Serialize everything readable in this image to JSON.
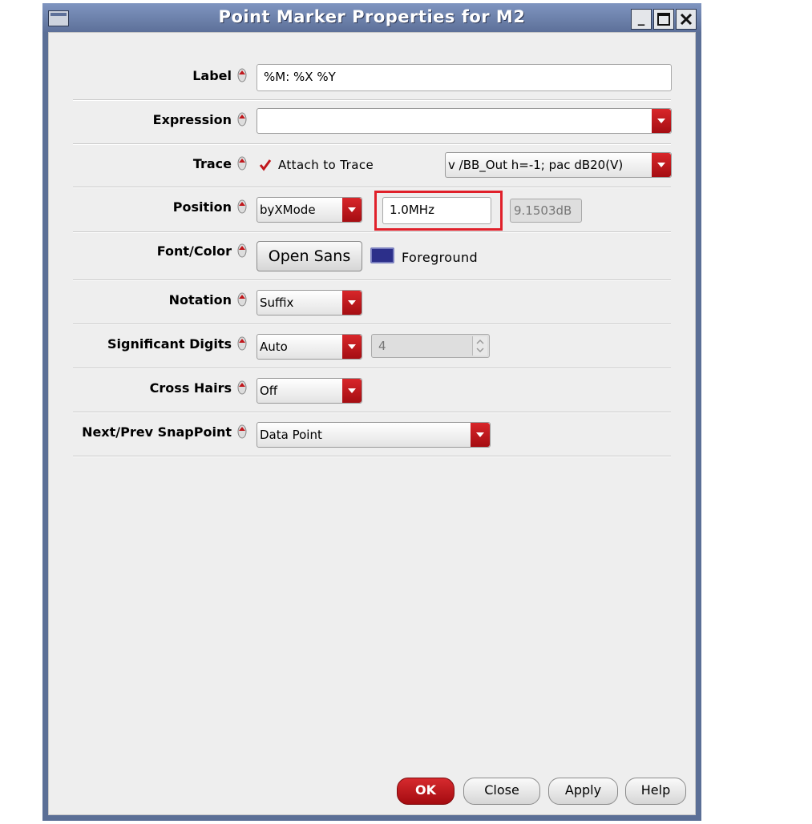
{
  "window": {
    "title": "Point Marker Properties for M2",
    "min_label": "_",
    "max_label": "☐",
    "close_label": "X"
  },
  "rows": {
    "label": {
      "label": "Label",
      "value": "%M: %X %Y"
    },
    "expression": {
      "label": "Expression",
      "value": ""
    },
    "trace": {
      "label": "Trace",
      "checkbox_label": "Attach to Trace",
      "checked": true,
      "select_value": "v /BB_Out h=-1; pac dB20(V)"
    },
    "position": {
      "label": "Position",
      "mode": "byXMode",
      "x_value": "1.0MHz",
      "y_value": "9.1503dB"
    },
    "font_color": {
      "label": "Font/Color",
      "font_button": "Open Sans",
      "color_label": "Foreground",
      "color": "#2c2f8a"
    },
    "notation": {
      "label": "Notation",
      "value": "Suffix"
    },
    "sig_digits": {
      "label": "Significant Digits",
      "value": "Auto",
      "spin_value": "4"
    },
    "cross_hairs": {
      "label": "Cross Hairs",
      "value": "Off"
    },
    "snap": {
      "label": "Next/Prev SnapPoint",
      "value": "Data Point"
    }
  },
  "buttons": {
    "ok": "OK",
    "close": "Close",
    "apply": "Apply",
    "help": "Help"
  },
  "colors": {
    "accent": "#c0171c",
    "highlight_box": "#e0202a"
  }
}
